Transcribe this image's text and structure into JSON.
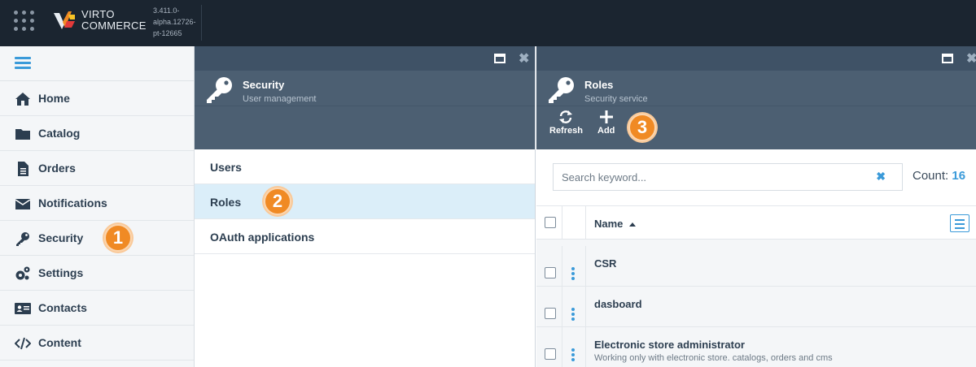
{
  "topbar": {
    "brand_line1": "VIRTO",
    "brand_line2": "COMMERCE",
    "version_lines": [
      "3.411.0-",
      "alpha.12726-",
      "pt-12665"
    ]
  },
  "nav": {
    "items": [
      {
        "label": "Home",
        "icon": "home-icon"
      },
      {
        "label": "Catalog",
        "icon": "folder-icon"
      },
      {
        "label": "Orders",
        "icon": "document-icon"
      },
      {
        "label": "Notifications",
        "icon": "envelope-icon"
      },
      {
        "label": "Security",
        "icon": "key-icon"
      },
      {
        "label": "Settings",
        "icon": "gears-icon"
      },
      {
        "label": "Contacts",
        "icon": "contact-card-icon"
      },
      {
        "label": "Content",
        "icon": "code-icon"
      }
    ]
  },
  "badges": {
    "one": "1",
    "two": "2",
    "three": "3"
  },
  "security_blade": {
    "title": "Security",
    "subtitle": "User management",
    "items": [
      "Users",
      "Roles",
      "OAuth applications"
    ],
    "active_item": "Roles"
  },
  "roles_blade": {
    "title": "Roles",
    "subtitle": "Security service",
    "toolbar": {
      "refresh": "Refresh",
      "add": "Add"
    },
    "search": {
      "placeholder": "Search keyword...",
      "value": ""
    },
    "count_label": "Count:",
    "count_value": "16",
    "grid": {
      "column_name": "Name",
      "rows": [
        {
          "name": "CSR",
          "description": ""
        },
        {
          "name": "dasboard",
          "description": ""
        },
        {
          "name": "Electronic store administrator",
          "description": "Working only with electronic store. catalogs, orders and cms"
        }
      ]
    }
  },
  "colors": {
    "topbar": "#1b2530",
    "blade_header": "#4c5f72",
    "accent": "#3a9ad9",
    "badge": "#f08a24",
    "active_row": "#dbeef9"
  }
}
